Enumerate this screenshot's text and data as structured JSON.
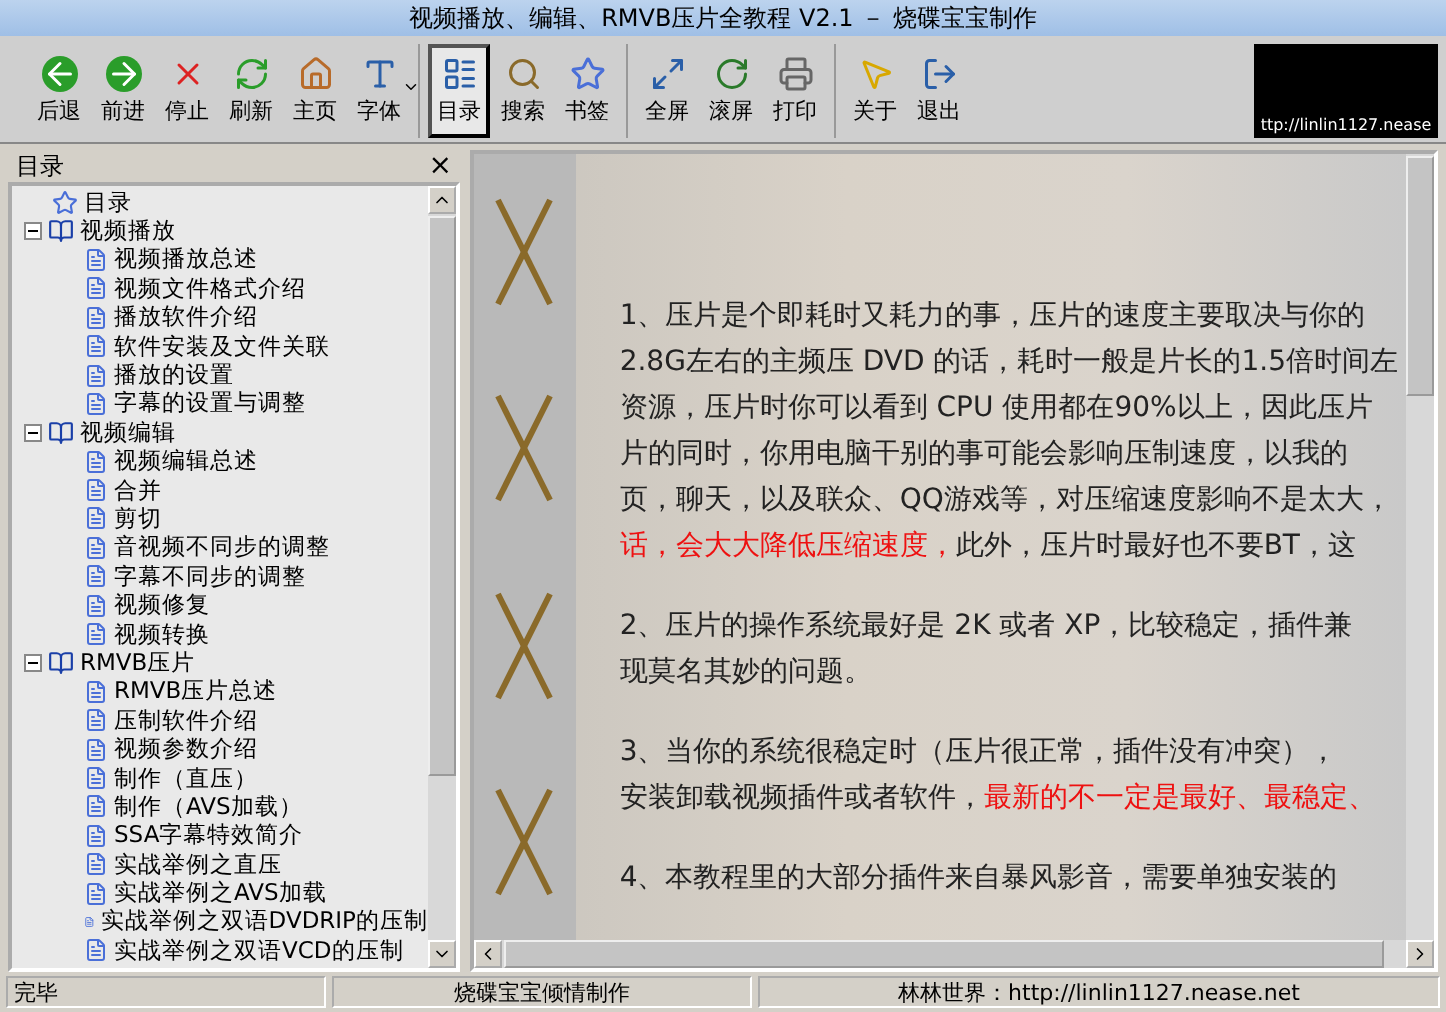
{
  "window": {
    "title": "视频播放、编辑、RMVB压片全教程 V2.1 － 烧碟宝宝制作"
  },
  "toolbar": {
    "groups": [
      [
        {
          "label": "后退",
          "selected": false
        },
        {
          "label": "前进",
          "selected": false
        },
        {
          "label": "停止",
          "selected": false
        },
        {
          "label": "刷新",
          "selected": false
        },
        {
          "label": "主页",
          "selected": false
        },
        {
          "label": "字体",
          "selected": false,
          "dropdown": true
        }
      ],
      [
        {
          "label": "目录",
          "selected": true
        },
        {
          "label": "搜索",
          "selected": false
        },
        {
          "label": "书签",
          "selected": false
        }
      ],
      [
        {
          "label": "全屏",
          "selected": false
        },
        {
          "label": "滚屏",
          "selected": false
        },
        {
          "label": "打印",
          "selected": false
        }
      ],
      [
        {
          "label": "关于",
          "selected": false
        },
        {
          "label": "退出",
          "selected": false
        }
      ]
    ],
    "logo_url": "ttp://linlin1127.nease"
  },
  "sidebar": {
    "title": "目录",
    "close": "×",
    "root": "目录",
    "groups": [
      {
        "label": "视频播放",
        "expanded": true,
        "children": [
          "视频播放总述",
          "视频文件格式介绍",
          "播放软件介绍",
          "软件安装及文件关联",
          "播放的设置",
          "字幕的设置与调整"
        ]
      },
      {
        "label": "视频编辑",
        "expanded": true,
        "children": [
          "视频编辑总述",
          "合并",
          "剪切",
          "音视频不同步的调整",
          "字幕不同步的调整",
          "视频修复",
          "视频转换"
        ]
      },
      {
        "label": "RMVB压片",
        "expanded": true,
        "children": [
          "RMVB压片总述",
          "压制软件介绍",
          "视频参数介绍",
          "制作（直压）",
          "制作（AVS加载）",
          "SSA字幕特效简介",
          "实战举例之直压",
          "实战举例之AVS加载",
          "实战举例之双语DVDRIP的压制",
          "实战举例之双语VCD的压制"
        ]
      }
    ]
  },
  "content": {
    "paragraphs": [
      [
        [
          {
            "text": "1、压片是个即耗时又耗力的事，压片的速度主要取决与你的",
            "emphasis": false
          }
        ],
        [
          {
            "text": "2.8G左右的主频压 DVD 的话，耗时一般是片长的1.5倍时间左",
            "emphasis": false
          }
        ],
        [
          {
            "text": "资源，压片时你可以看到 CPU 使用都在90%以上，因此压片",
            "emphasis": false
          }
        ],
        [
          {
            "text": "片的同时，你用电脑干别的事可能会影响压制速度，以我的",
            "emphasis": false
          }
        ],
        [
          {
            "text": "页，聊天，以及联众、QQ游戏等，对压缩速度影响不是太大，",
            "emphasis": false
          }
        ],
        [
          {
            "text": "话，会大大降低压缩速度，",
            "emphasis": true
          },
          {
            "text": "此外，压片时最好也不要BT，这",
            "emphasis": false
          }
        ]
      ],
      [
        [
          {
            "text": "2、压片的操作系统最好是 2K 或者 XP，比较稳定，插件兼",
            "emphasis": false
          }
        ],
        [
          {
            "text": "现莫名其妙的问题。",
            "emphasis": false
          }
        ]
      ],
      [
        [
          {
            "text": "3、当你的系统很稳定时（压片很正常，插件没有冲突），",
            "emphasis": false
          }
        ],
        [
          {
            "text": "安装卸载视频插件或者软件，",
            "emphasis": false
          },
          {
            "text": "最新的不一定是最好、最稳定、",
            "emphasis": true
          }
        ]
      ],
      [
        [
          {
            "text": "4、本教程里的大部分插件来自暴风影音，需要单独安装的",
            "emphasis": false
          }
        ]
      ]
    ]
  },
  "status_bar": [
    "完毕",
    "烧碟宝宝倾情制作",
    "林林世界：http://linlin1127.nease.net"
  ]
}
